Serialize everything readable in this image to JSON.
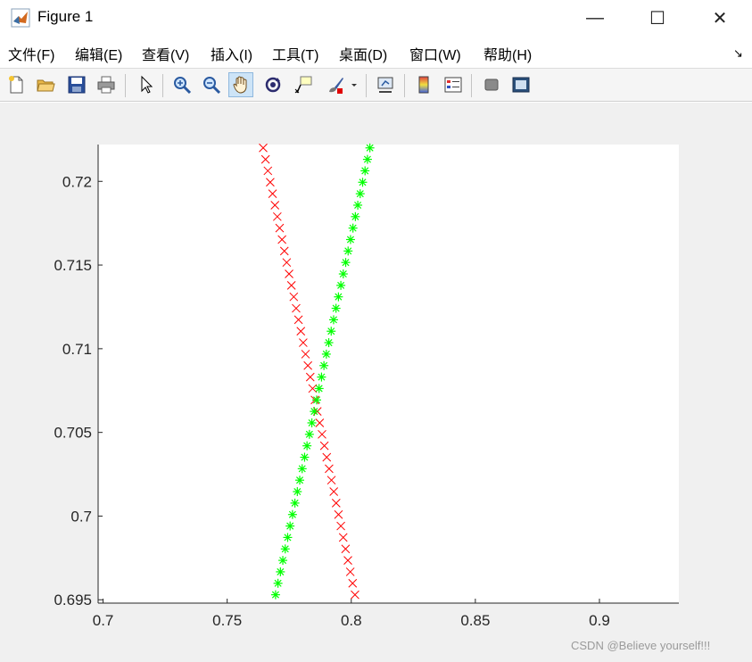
{
  "window": {
    "title": "Figure 1",
    "minimize_glyph": "—",
    "maximize_glyph": "☐",
    "close_glyph": "✕"
  },
  "menu": {
    "items": [
      {
        "label": "文件(F)"
      },
      {
        "label": "编辑(E)"
      },
      {
        "label": "查看(V)"
      },
      {
        "label": "插入(I)"
      },
      {
        "label": "工具(T)"
      },
      {
        "label": "桌面(D)"
      },
      {
        "label": "窗口(W)"
      },
      {
        "label": "帮助(H)"
      }
    ],
    "corner_glyph": "↘"
  },
  "toolbar": {
    "buttons": [
      {
        "name": "new-figure",
        "icon": "new-document-icon"
      },
      {
        "name": "open-file",
        "icon": "open-folder-icon"
      },
      {
        "name": "save-figure",
        "icon": "save-icon"
      },
      {
        "name": "print-figure",
        "icon": "print-icon"
      },
      {
        "name": "edit-plot",
        "icon": "pointer-arrow-icon"
      },
      {
        "name": "zoom-in",
        "icon": "zoom-in-icon"
      },
      {
        "name": "zoom-out",
        "icon": "zoom-out-icon"
      },
      {
        "name": "pan",
        "icon": "hand-icon",
        "active": true
      },
      {
        "name": "rotate-3d",
        "icon": "rotate-icon"
      },
      {
        "name": "data-cursor",
        "icon": "data-cursor-icon"
      },
      {
        "name": "brush",
        "icon": "brush-icon"
      },
      {
        "name": "link-plot",
        "icon": "link-plot-icon"
      },
      {
        "name": "insert-colorbar",
        "icon": "colorbar-icon"
      },
      {
        "name": "insert-legend",
        "icon": "legend-icon"
      },
      {
        "name": "hide-plot-tools",
        "icon": "hide-tools-icon"
      },
      {
        "name": "show-plot-tools",
        "icon": "show-tools-icon"
      }
    ]
  },
  "watermark": "CSDN @Believe yourself!!!",
  "chart_data": {
    "type": "scatter",
    "xlim": [
      0.698,
      0.932
    ],
    "ylim": [
      0.6948,
      0.7222
    ],
    "xticks": [
      "0.7",
      "0.75",
      "0.8",
      "0.85",
      "0.9"
    ],
    "xtick_values": [
      0.7,
      0.75,
      0.8,
      0.85,
      0.9
    ],
    "yticks": [
      "0.695",
      "0.7",
      "0.705",
      "0.71",
      "0.715",
      "0.72"
    ],
    "ytick_values": [
      0.695,
      0.7,
      0.705,
      0.71,
      0.715,
      0.72
    ],
    "grid": false,
    "colors": {
      "red_series": "#ff0000",
      "green_series": "#00ff00"
    },
    "series": [
      {
        "marker": "x",
        "color": "#ff0000",
        "x_start": 0.8015,
        "y_start": 0.6953,
        "x_end": 0.7645,
        "y_end": 0.722,
        "points": 40
      },
      {
        "marker": "*",
        "color": "#00ff00",
        "x_start": 0.7695,
        "y_start": 0.6953,
        "x_end": 0.8075,
        "y_end": 0.722,
        "points": 40
      }
    ]
  }
}
